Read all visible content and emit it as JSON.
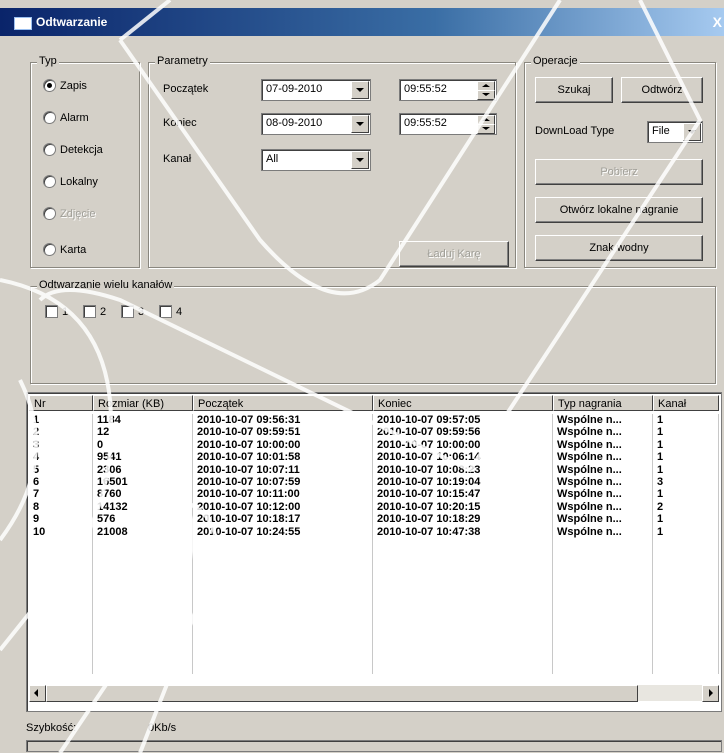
{
  "window": {
    "title": "Odtwarzanie",
    "close_label": "X"
  },
  "type_group": {
    "label": "Typ",
    "options": [
      {
        "label": "Zapis",
        "selected": true,
        "disabled": false
      },
      {
        "label": "Alarm",
        "selected": false,
        "disabled": false
      },
      {
        "label": "Detekcja",
        "selected": false,
        "disabled": false
      },
      {
        "label": "Lokalny",
        "selected": false,
        "disabled": false
      },
      {
        "label": "Zdjęcie",
        "selected": false,
        "disabled": true
      },
      {
        "label": "Karta",
        "selected": false,
        "disabled": false
      }
    ]
  },
  "params": {
    "label": "Parametry",
    "start_label": "Początek",
    "start_date": "07-09-2010",
    "start_time": "09:55:52",
    "end_label": "Koniec",
    "end_date": "08-09-2010",
    "end_time": "09:55:52",
    "channel_label": "Kanał",
    "channel_value": "All",
    "card_button": "Ładuj Karę"
  },
  "operations": {
    "label": "Operacje",
    "search_button": "Szukaj",
    "play_button": "Odtwórz",
    "download_type_label": "DownLoad Type",
    "download_type_value": "File",
    "download_button": "Pobierz",
    "open_local_button": "Otwórz lokalne nagranie",
    "watermark_button": "Znak wodny"
  },
  "multi": {
    "label": "Odtwarzanie wielu kanałów",
    "channels": [
      "1",
      "2",
      "3",
      "4"
    ]
  },
  "table": {
    "headers": [
      "Nr",
      "Rozmiar (KB)",
      "Początek",
      "Koniec",
      "Typ nagrania",
      "Kanał"
    ],
    "rows": [
      [
        "1",
        "1184",
        "2010-10-07 09:56:31",
        "2010-10-07 09:57:05",
        "Wspólne n...",
        "1"
      ],
      [
        "2",
        "12",
        "2010-10-07 09:59:51",
        "2010-10-07 09:59:56",
        "Wspólne n...",
        "1"
      ],
      [
        "3",
        "0",
        "2010-10-07 10:00:00",
        "2010-10-07 10:00:00",
        "Wspólne n...",
        "1"
      ],
      [
        "4",
        "9541",
        "2010-10-07 10:01:58",
        "2010-10-07 10:06:14",
        "Wspólne n...",
        "1"
      ],
      [
        "5",
        "2306",
        "2010-10-07 10:07:11",
        "2010-10-07 10:08:23",
        "Wspólne n...",
        "1"
      ],
      [
        "6",
        "16501",
        "2010-10-07 10:07:59",
        "2010-10-07 10:19:04",
        "Wspólne n...",
        "3"
      ],
      [
        "7",
        "8760",
        "2010-10-07 10:11:00",
        "2010-10-07 10:15:47",
        "Wspólne n...",
        "1"
      ],
      [
        "8",
        "14132",
        "2010-10-07 10:12:00",
        "2010-10-07 10:20:15",
        "Wspólne n...",
        "2"
      ],
      [
        "9",
        "576",
        "2010-10-07 10:18:17",
        "2010-10-07 10:18:29",
        "Wspólne n...",
        "1"
      ],
      [
        "10",
        "21008",
        "2010-10-07 10:24:55",
        "2010-10-07 10:47:38",
        "Wspólne n...",
        "1"
      ]
    ]
  },
  "status": {
    "speed_label": "Szybkość:",
    "speed_value": "0Kb/s"
  },
  "colors": {
    "face": "#d4d0c8",
    "title_start": "#0a246a",
    "title_end": "#a6caf0"
  }
}
